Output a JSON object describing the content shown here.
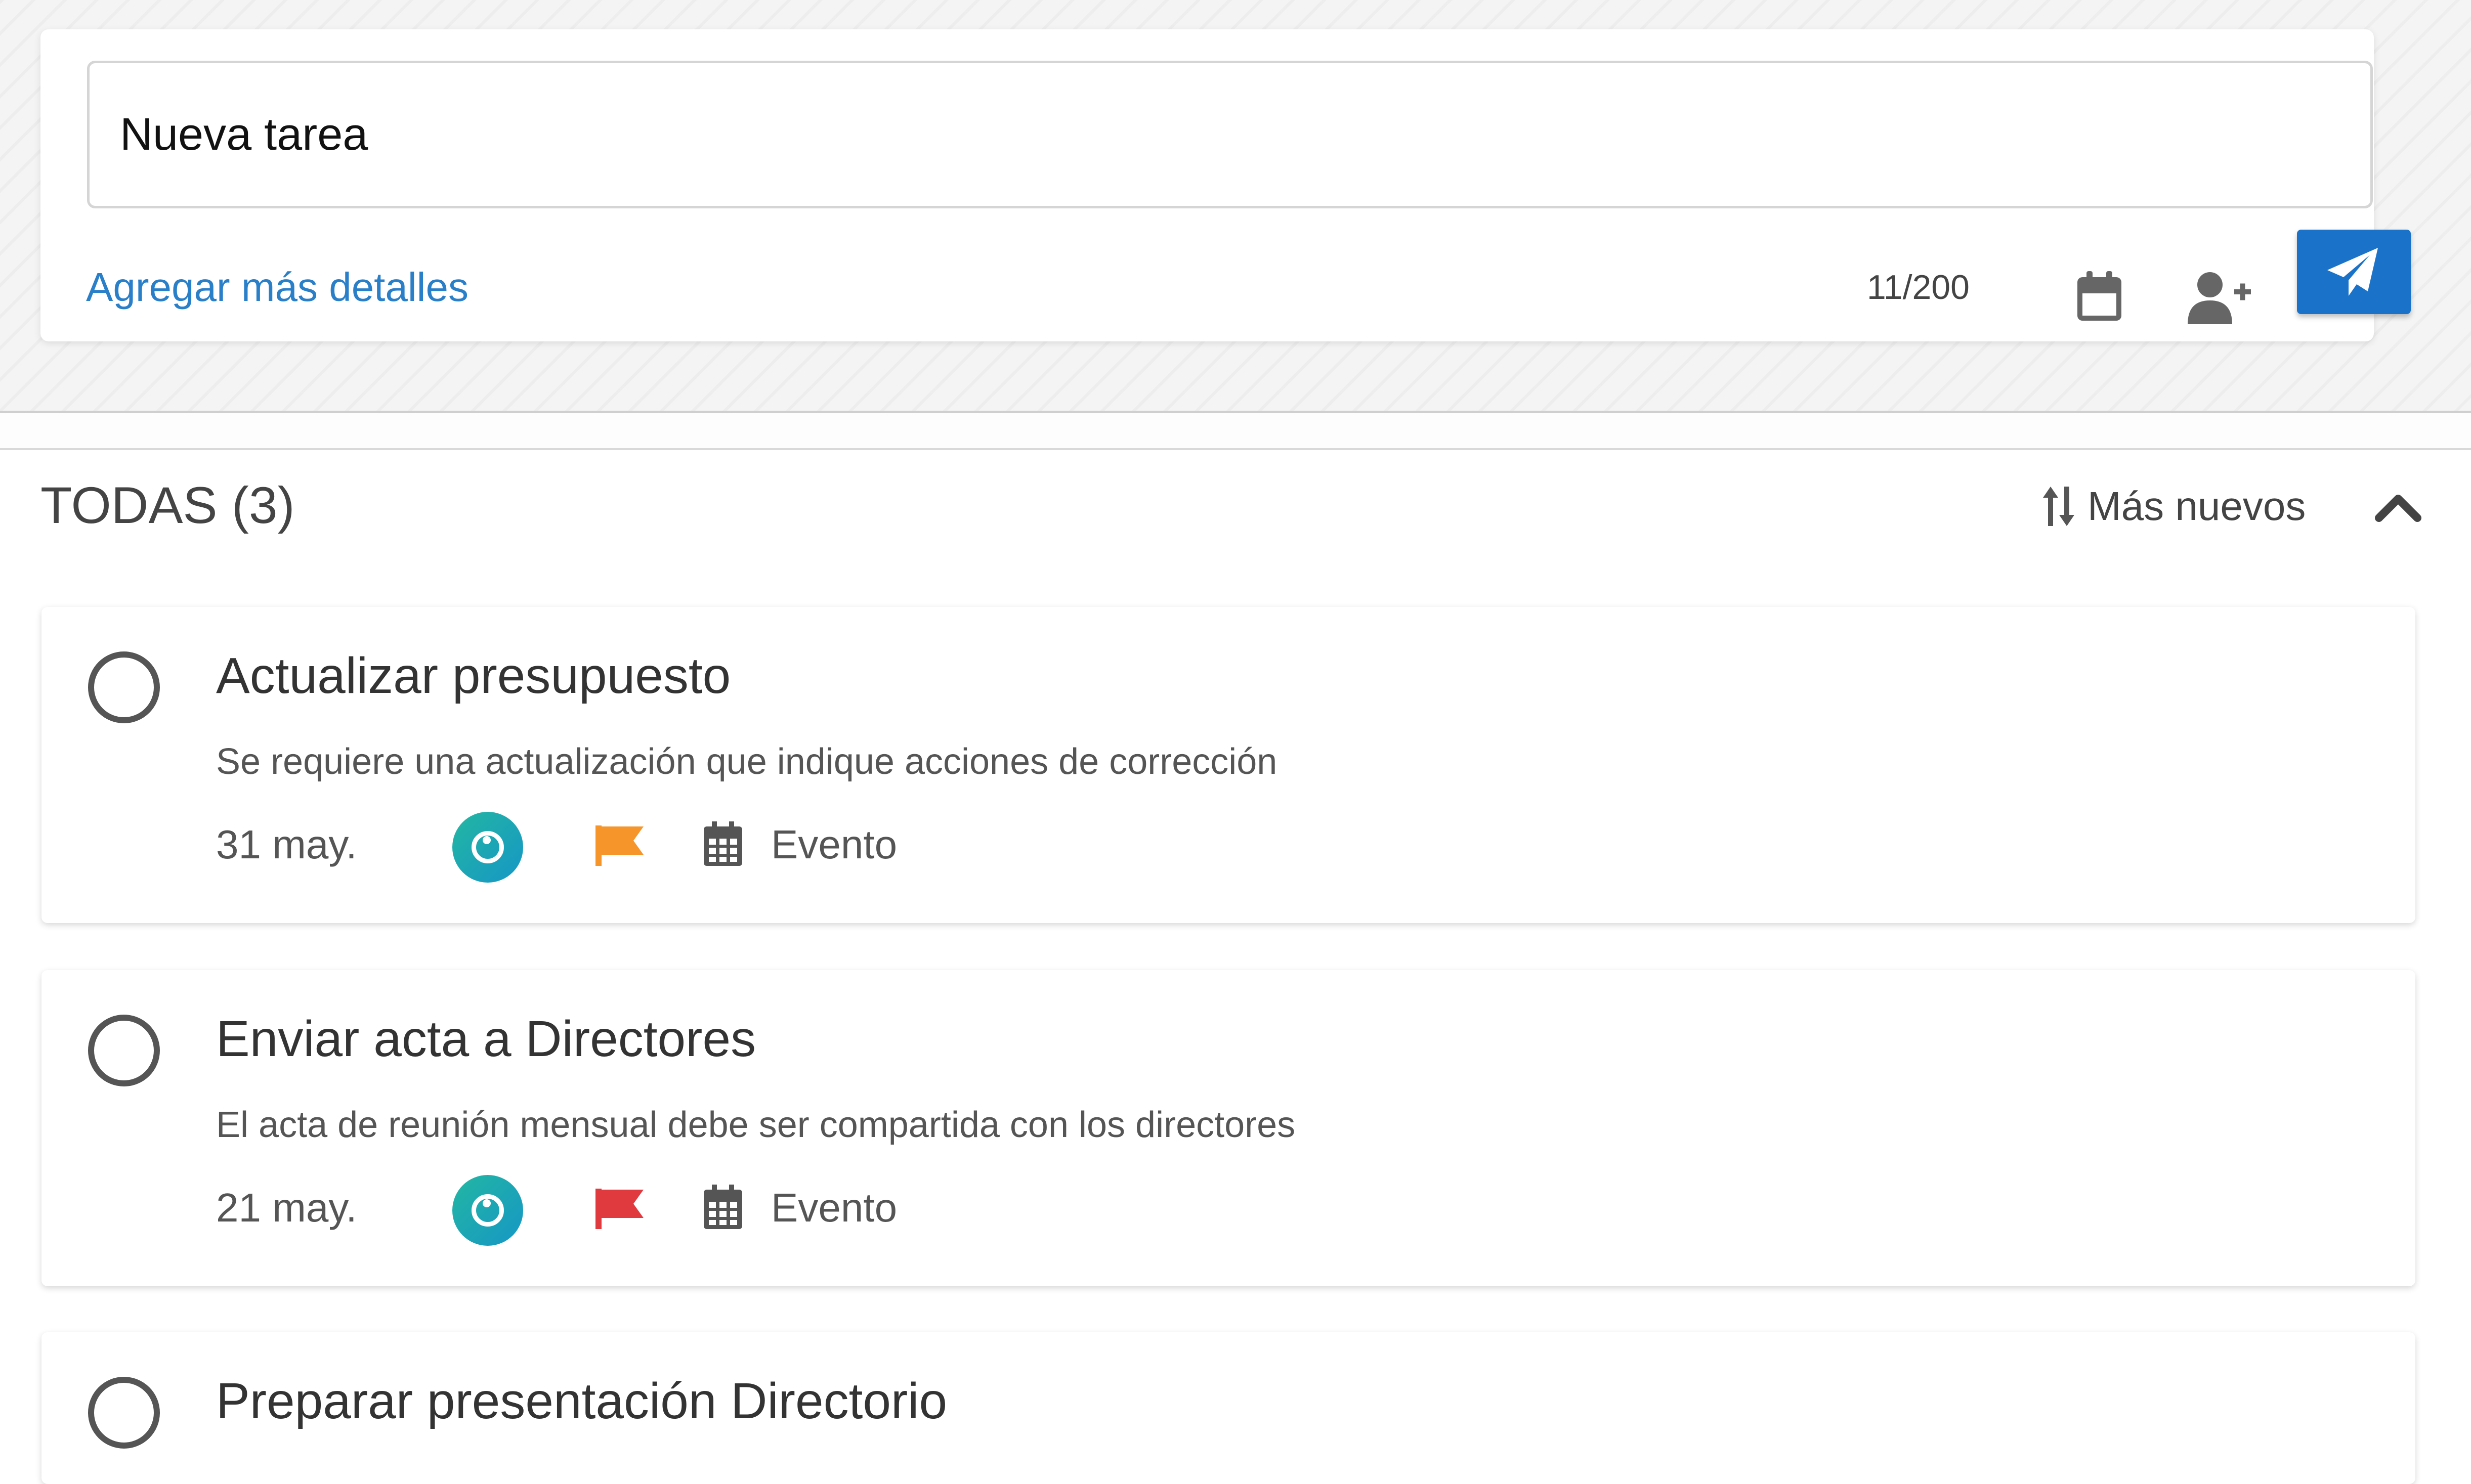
{
  "composer": {
    "input_value": "Nueva tarea",
    "more_details_label": "Agregar más detalles",
    "char_counter": "11/200"
  },
  "icons": {
    "calendar": "calendar-icon",
    "add_user": "user-plus-icon",
    "send": "paper-plane-icon",
    "sort": "sort-arrows-icon",
    "collapse": "chevron-up-icon",
    "checkbox": "circle-outline-icon",
    "assignee": "avatar-icon",
    "priority": "flag-icon",
    "event": "calendar-grid-icon"
  },
  "colors": {
    "accent": "#1a73c8",
    "link": "#2a7fc9",
    "flag_medium": "#f5952a",
    "flag_high": "#e0393e",
    "avatar_start": "#23b7a2",
    "avatar_end": "#1696c6"
  },
  "list": {
    "title": "TODAS (3)",
    "sort_label": "Más nuevos"
  },
  "tasks": [
    {
      "title": "Actualizar presupuesto",
      "description": "Se requiere una actualización que indique acciones de corrección",
      "date": "31 may.",
      "flag_color": "#f5952a",
      "event_label": "Evento"
    },
    {
      "title": "Enviar acta a Directores",
      "description": "El acta de reunión mensual debe ser compartida con los directores",
      "date": "21 may.",
      "flag_color": "#e0393e",
      "event_label": "Evento"
    },
    {
      "title": "Preparar presentación Directorio"
    }
  ]
}
